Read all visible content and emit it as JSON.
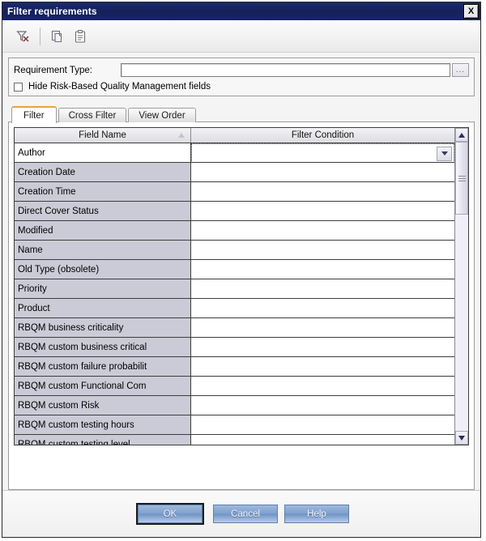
{
  "window": {
    "title": "Filter requirements",
    "close_label": "X"
  },
  "toolbar": {
    "items": [
      {
        "name": "clear-filter-icon",
        "label": "Clear Filter"
      },
      {
        "name": "copy-icon",
        "label": "Copy Filter"
      },
      {
        "name": "paste-icon",
        "label": "Paste Filter"
      }
    ]
  },
  "top_group": {
    "requirement_type_label": "Requirement Type:",
    "requirement_type_value": "",
    "requirement_type_placeholder": "",
    "browse_label": "...",
    "hide_rbqm_label": "Hide Risk-Based Quality Management fields",
    "hide_rbqm_checked": false
  },
  "tabs": [
    {
      "label": "Filter",
      "active": true
    },
    {
      "label": "Cross Filter",
      "active": false
    },
    {
      "label": "View Order",
      "active": false
    }
  ],
  "grid": {
    "columns": [
      {
        "label": "Field Name",
        "sort": "asc"
      },
      {
        "label": "Filter Condition",
        "sort": ""
      }
    ],
    "rows": [
      {
        "field": "Author",
        "condition": "",
        "selected": true
      },
      {
        "field": "Creation Date",
        "condition": "",
        "selected": false
      },
      {
        "field": "Creation Time",
        "condition": "",
        "selected": false
      },
      {
        "field": "Direct Cover Status",
        "condition": "",
        "selected": false
      },
      {
        "field": "Modified",
        "condition": "",
        "selected": false
      },
      {
        "field": "Name",
        "condition": "",
        "selected": false
      },
      {
        "field": "Old Type (obsolete)",
        "condition": "",
        "selected": false
      },
      {
        "field": "Priority",
        "condition": "",
        "selected": false
      },
      {
        "field": "Product",
        "condition": "",
        "selected": false
      },
      {
        "field": "RBQM business criticality",
        "condition": "",
        "selected": false
      },
      {
        "field": "RBQM custom business critical",
        "condition": "",
        "selected": false
      },
      {
        "field": "RBQM custom failure probabilit",
        "condition": "",
        "selected": false
      },
      {
        "field": "RBQM custom Functional Com",
        "condition": "",
        "selected": false
      },
      {
        "field": "RBQM custom Risk",
        "condition": "",
        "selected": false
      },
      {
        "field": "RBQM custom testing hours",
        "condition": "",
        "selected": false
      },
      {
        "field": "RBQM custom testing level",
        "condition": "",
        "selected": false
      }
    ]
  },
  "footer": {
    "ok_label": "OK",
    "cancel_label": "Cancel",
    "help_label": "Help"
  },
  "colors": {
    "titlebar": "#16246a",
    "tab_accent": "#e8a33d",
    "row_field_bg": "#cbcbd7",
    "button_blue": "#7fa0cd"
  }
}
